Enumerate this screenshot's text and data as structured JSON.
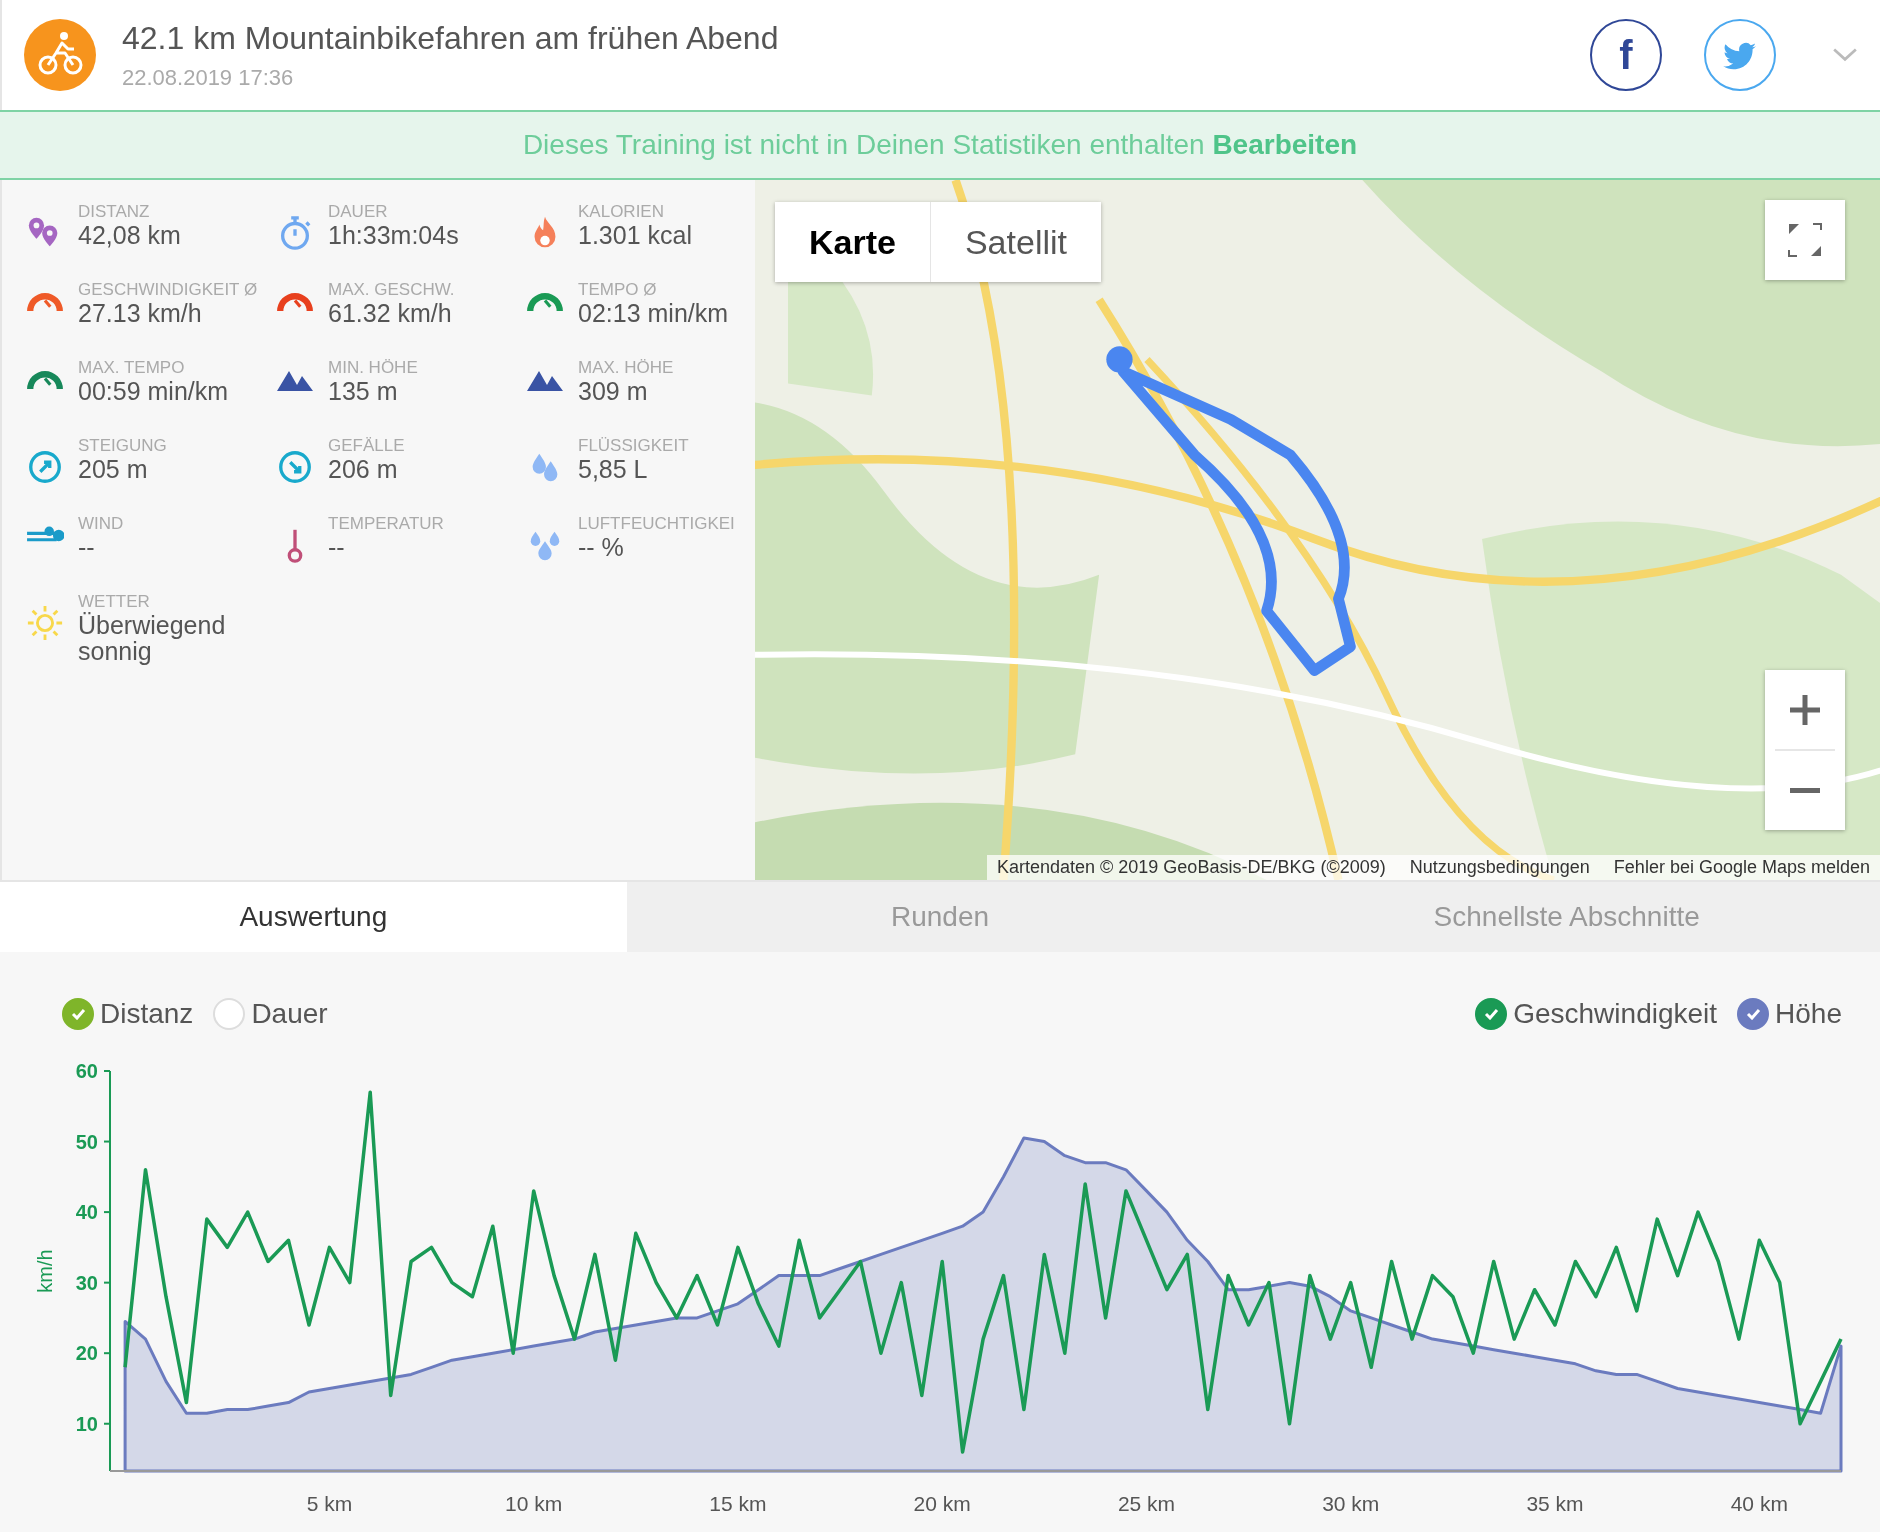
{
  "header": {
    "title": "42.1 km Mountainbikefahren am frühen Abend",
    "date": "22.08.2019 17:36",
    "facebook_label": "f"
  },
  "banner": {
    "text": "Dieses Training ist nicht in Deinen Statistiken enthalten",
    "link": "Bearbeiten"
  },
  "stats": [
    {
      "kind": "pins",
      "color": "#a566c2",
      "label": "DISTANZ",
      "value": "42,08 km"
    },
    {
      "kind": "stopwatch",
      "color": "#6fa8f0",
      "label": "DAUER",
      "value": "1h:33m:04s"
    },
    {
      "kind": "flame",
      "color": "#f5805a",
      "label": "KALORIEN",
      "value": "1.301 kcal"
    },
    {
      "kind": "gauge",
      "color": "#ef5a28",
      "label": "GESCHWINDIGKEIT Ø",
      "value": "27.13 km/h"
    },
    {
      "kind": "gauge",
      "color": "#e8401e",
      "label": "MAX. GESCHW.",
      "value": "61.32 km/h"
    },
    {
      "kind": "gauge",
      "color": "#1a9a55",
      "label": "TEMPO Ø",
      "value": "02:13 min/km"
    },
    {
      "kind": "gauge",
      "color": "#17885a",
      "label": "MAX. TEMPO",
      "value": "00:59 min/km"
    },
    {
      "kind": "mountains",
      "color": "#3953a4",
      "label": "MIN. HÖHE",
      "value": "135 m"
    },
    {
      "kind": "mountains",
      "color": "#3953a4",
      "label": "MAX. HÖHE",
      "value": "309 m"
    },
    {
      "kind": "up",
      "color": "#18a9cc",
      "label": "STEIGUNG",
      "value": "205 m"
    },
    {
      "kind": "down",
      "color": "#18a9cc",
      "label": "GEFÄLLE",
      "value": "206 m"
    },
    {
      "kind": "drops",
      "color": "#8fb8f5",
      "label": "FLÜSSIGKEIT",
      "value": "5,85 L"
    },
    {
      "kind": "wind",
      "color": "#1b9bc9",
      "label": "WIND",
      "value": "--"
    },
    {
      "kind": "thermometer",
      "color": "#c04f78",
      "label": "TEMPERATUR",
      "value": "--"
    },
    {
      "kind": "humidity",
      "color": "#8fb8f5",
      "label": "LUFTFEUCHTIGKEI",
      "value": "-- %"
    },
    {
      "kind": "sun",
      "color": "#f8d84a",
      "label": "WETTER",
      "value": "Überwiegend sonnig"
    }
  ],
  "map": {
    "map_types": [
      {
        "label": "Karte",
        "selected": true
      },
      {
        "label": "Satellit",
        "selected": false
      }
    ],
    "attribution": [
      "Kartendaten © 2019 GeoBasis-DE/BKG (©2009)",
      "Nutzungsbedingungen",
      "Fehler bei Google Maps melden"
    ]
  },
  "tabs": [
    {
      "label": "Auswertung",
      "selected": true
    },
    {
      "label": "Runden",
      "selected": false
    },
    {
      "label": "Schnellste Abschnitte",
      "selected": false
    }
  ],
  "x_modes": [
    {
      "label": "Distanz",
      "selected": true
    },
    {
      "label": "Dauer",
      "selected": false
    }
  ],
  "series_toggles": [
    {
      "checked": true
    },
    {
      "checked": true
    }
  ],
  "chart_data": {
    "type": "line",
    "ylabel": "km/h",
    "xlim": [
      -0.37,
      42
    ],
    "ylim": [
      3.3,
      60
    ],
    "yticks": [
      10,
      20,
      30,
      40,
      50,
      60
    ],
    "xticks": [
      {
        "value": 5,
        "label": "5 km"
      },
      {
        "value": 10,
        "label": "10 km"
      },
      {
        "value": 15,
        "label": "15 km"
      },
      {
        "value": 20,
        "label": "20 km"
      },
      {
        "value": 25,
        "label": "25 km"
      },
      {
        "value": 30,
        "label": "30 km"
      },
      {
        "value": 35,
        "label": "35 km"
      },
      {
        "value": 40,
        "label": "40 km"
      }
    ],
    "x": [
      0,
      0.5,
      1,
      1.5,
      2,
      2.5,
      3,
      3.5,
      4,
      4.5,
      5,
      5.5,
      6,
      6.5,
      7,
      7.5,
      8,
      8.5,
      9,
      9.5,
      10,
      10.5,
      11,
      11.5,
      12,
      12.5,
      13,
      13.5,
      14,
      14.5,
      15,
      15.5,
      16,
      16.5,
      17,
      17.5,
      18,
      18.5,
      19,
      19.5,
      20,
      20.5,
      21,
      21.5,
      22,
      22.5,
      23,
      23.5,
      24,
      24.5,
      25,
      25.5,
      26,
      26.5,
      27,
      27.5,
      28,
      28.5,
      29,
      29.5,
      30,
      30.5,
      31,
      31.5,
      32,
      32.5,
      33,
      33.5,
      34,
      34.5,
      35,
      35.5,
      36,
      36.5,
      37,
      37.5,
      38,
      38.5,
      39,
      39.5,
      40,
      40.5,
      41,
      41.5,
      42
    ],
    "series": [
      {
        "name": "Höhe",
        "type": "area",
        "color": "#6b7bbf",
        "values": [
          24.5,
          22,
          16,
          11.5,
          11.5,
          12,
          12,
          12.5,
          13,
          14.5,
          15,
          15.5,
          16,
          16.5,
          17,
          18,
          19,
          19.5,
          20,
          20.5,
          21,
          21.5,
          22,
          23,
          23.5,
          24,
          24.5,
          25,
          25,
          26,
          27,
          29,
          31,
          31,
          31,
          32,
          33,
          34,
          35,
          36,
          37,
          38,
          40,
          45,
          50.5,
          50,
          48,
          47,
          47,
          46,
          43,
          40,
          36,
          33,
          29,
          29,
          29.5,
          30,
          29.5,
          28,
          26,
          25,
          24,
          23,
          22,
          21.5,
          21,
          20.5,
          20,
          19.5,
          19,
          18.5,
          17.5,
          17,
          17,
          16,
          15,
          14.5,
          14,
          13.5,
          13,
          12.5,
          12,
          11.5,
          21
        ]
      },
      {
        "name": "Geschwindigkeit",
        "color": "#1a9a55",
        "values": [
          18,
          46,
          28,
          13,
          39,
          35,
          40,
          33,
          36,
          24,
          35,
          30,
          57,
          14,
          33,
          35,
          30,
          28,
          38,
          20,
          43,
          31,
          22,
          34,
          19,
          37,
          30,
          25,
          31,
          24,
          35,
          27,
          21,
          36,
          25,
          29,
          33,
          20,
          30,
          14,
          33,
          6,
          22,
          31,
          12,
          34,
          20,
          44,
          25,
          43,
          36,
          29,
          34,
          12,
          31,
          24,
          30,
          10,
          31,
          22,
          30,
          18,
          33,
          22,
          31,
          28,
          20,
          33,
          22,
          29,
          24,
          33,
          28,
          35,
          26,
          39,
          31,
          40,
          33,
          22,
          36,
          30,
          10,
          16,
          22
        ]
      }
    ]
  }
}
